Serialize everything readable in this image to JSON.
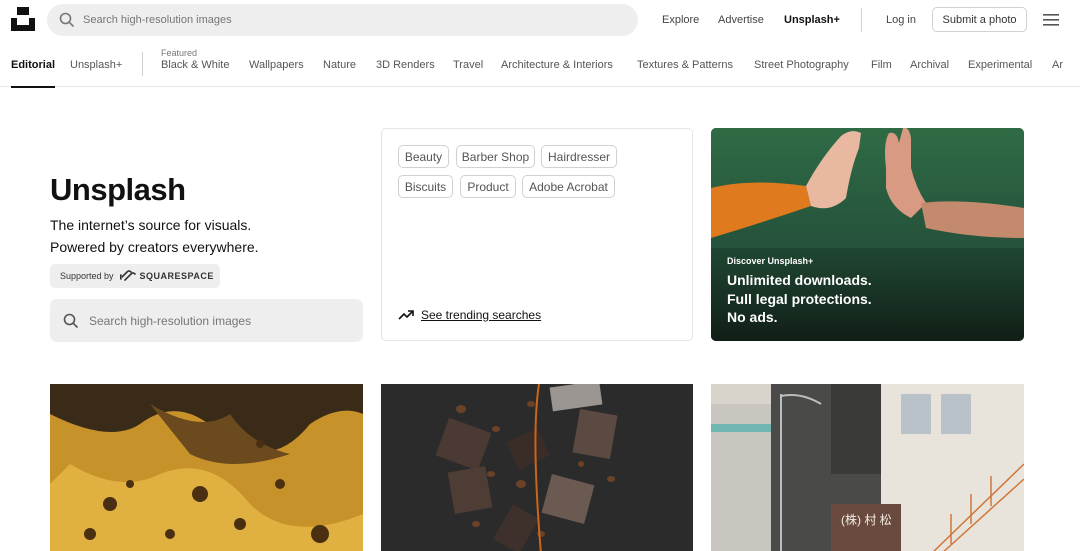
{
  "header": {
    "logo_icon": "unsplash-logo-icon",
    "search_placeholder": "Search high-resolution images",
    "nav": {
      "explore": "Explore",
      "advertise": "Advertise",
      "unsplash_plus": "Unsplash+",
      "login": "Log in",
      "submit": "Submit a photo"
    },
    "menu_icon": "hamburger-menu-icon"
  },
  "categories": {
    "editorial": "Editorial",
    "unsplash_plus": "Unsplash+",
    "featured_label": "Featured",
    "items": [
      "Black & White",
      "Wallpapers",
      "Nature",
      "3D Renders",
      "Travel",
      "Architecture & Interiors",
      "Textures & Patterns",
      "Street Photography",
      "Film",
      "Archival",
      "Experimental",
      "Ar"
    ]
  },
  "hero": {
    "title": "Unsplash",
    "line1": "The internet’s source for visuals.",
    "line2": "Powered by creators everywhere.",
    "supported_by": "Supported by",
    "sponsor_name": "SQUARESPACE",
    "search_placeholder": "Search high-resolution images"
  },
  "trending": {
    "tags": [
      "Beauty",
      "Barber Shop",
      "Hairdresser",
      "Biscuits",
      "Product",
      "Adobe Acrobat"
    ],
    "link": "See trending searches",
    "icon": "trending-up-icon"
  },
  "promo": {
    "kicker": "Discover Unsplash+",
    "line1": "Unlimited downloads.",
    "line2": "Full legal protections.",
    "line3": "No ads."
  },
  "photos": {
    "sign_text": "(株) 村 松"
  },
  "colors": {
    "promo_bg": "#2d5a3c",
    "accent": "#111111"
  }
}
